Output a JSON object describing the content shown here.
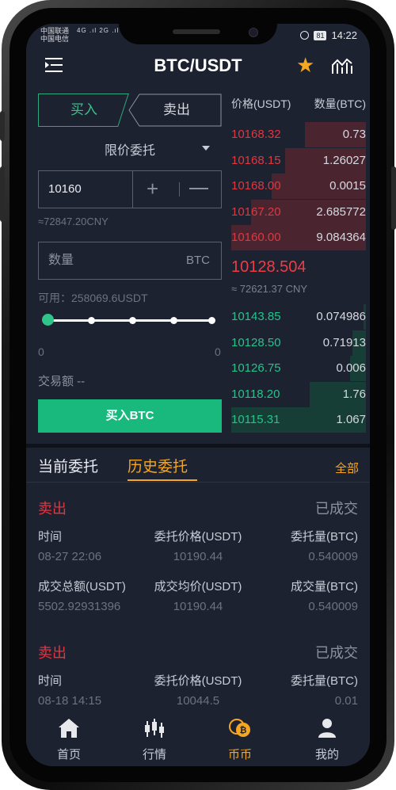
{
  "status_bar": {
    "carrier1": "中国联通",
    "carrier2": "中国电信",
    "signal": "4G .ıl 2G .ıl",
    "battery": "81",
    "time": "14:22"
  },
  "header": {
    "menu_icon": "menu-icon",
    "title": "BTC/USDT",
    "favorite_icon": "star-icon",
    "chart_icon": "chart-icon"
  },
  "trade_form": {
    "buy_tab": "买入",
    "sell_tab": "卖出",
    "order_type": "限价委托",
    "price_value": "10160",
    "plus": "+",
    "price_cny_estimate": "≈72847.20CNY",
    "quantity_placeholder": "数量",
    "quantity_unit": "BTC",
    "available": "可用：258069.6USDT",
    "slider_min": "0",
    "slider_max": "0",
    "slider_level": 0,
    "trade_amount": "交易额 --",
    "buy_button": "买入BTC"
  },
  "order_book": {
    "price_header": "价格(USDT)",
    "qty_header": "数量(BTC)",
    "asks": [
      {
        "price": "10168.32",
        "qty": "0.73",
        "depth": 0.45
      },
      {
        "price": "10168.15",
        "qty": "1.26027",
        "depth": 0.6
      },
      {
        "price": "10168.00",
        "qty": "0.0015",
        "depth": 0.7
      },
      {
        "price": "10167.20",
        "qty": "2.685772",
        "depth": 0.85
      },
      {
        "price": "10160.00",
        "qty": "9.084364",
        "depth": 1.0
      }
    ],
    "last_price": "10128.504",
    "last_price_cny": "≈ 72621.37 CNY",
    "bids": [
      {
        "price": "10143.85",
        "qty": "0.074986",
        "depth": 0.02
      },
      {
        "price": "10128.50",
        "qty": "0.71913",
        "depth": 0.1
      },
      {
        "price": "10126.75",
        "qty": "0.006",
        "depth": 0.12
      },
      {
        "price": "10118.20",
        "qty": "1.76",
        "depth": 0.42
      },
      {
        "price": "10115.31",
        "qty": "1.067",
        "depth": 1.0
      }
    ]
  },
  "orders_section": {
    "tab_current": "当前委托",
    "tab_history": "历史委托",
    "all_link": "全部",
    "orders": [
      {
        "side": "卖出",
        "status": "已成交",
        "labels": [
          "时间",
          "委托价格(USDT)",
          "委托量(BTC)"
        ],
        "values": [
          "08-27 22:06",
          "10190.44",
          "0.540009"
        ],
        "labels2": [
          "成交总额(USDT)",
          "成交均价(USDT)",
          "成交量(BTC)"
        ],
        "values2": [
          "5502.92931396",
          "10190.44",
          "0.540009"
        ]
      },
      {
        "side": "卖出",
        "status": "已成交",
        "labels": [
          "时间",
          "委托价格(USDT)",
          "委托量(BTC)"
        ],
        "values": [
          "08-18 14:15",
          "10044.5",
          "0.01"
        ]
      }
    ]
  },
  "tab_bar": {
    "items": [
      {
        "label": "首页",
        "icon": "home-icon"
      },
      {
        "label": "行情",
        "icon": "candlestick-icon"
      },
      {
        "label": "币币",
        "icon": "coin-exchange-icon",
        "active": true
      },
      {
        "label": "我的",
        "icon": "user-icon"
      }
    ]
  },
  "colors": {
    "background": "#1d2230",
    "buy_green": "#19b97d",
    "sell_red": "#e2363f",
    "accent_orange": "#f5a623"
  }
}
